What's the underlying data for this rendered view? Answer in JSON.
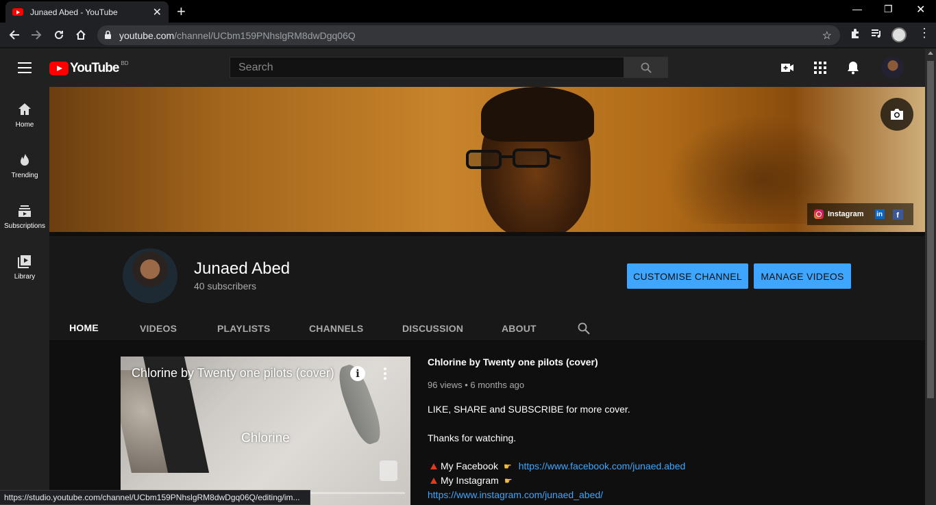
{
  "browser": {
    "tab_title": "Junaed Abed - YouTube",
    "url_host": "youtube.com",
    "url_path": "/channel/UCbm159PNhslgRM8dwDgq06Q",
    "status_url": "https://studio.youtube.com/channel/UCbm159PNhslgRM8dwDgq06Q/editing/im..."
  },
  "header": {
    "logo_text": "YouTube",
    "region": "BD",
    "search_placeholder": "Search"
  },
  "guide": {
    "items": [
      {
        "label": "Home",
        "icon": "home-icon"
      },
      {
        "label": "Trending",
        "icon": "flame-icon"
      },
      {
        "label": "Subscriptions",
        "icon": "subscriptions-icon"
      },
      {
        "label": "Library",
        "icon": "library-icon"
      }
    ]
  },
  "banner": {
    "links": {
      "instagram": "Instagram"
    }
  },
  "channel": {
    "name": "Junaed Abed",
    "subscribers": "40 subscribers",
    "customise_label": "CUSTOMISE CHANNEL",
    "manage_label": "MANAGE VIDEOS",
    "tabs": [
      "HOME",
      "VIDEOS",
      "PLAYLISTS",
      "CHANNELS",
      "DISCUSSION",
      "ABOUT"
    ]
  },
  "featured": {
    "player_title": "Chlorine by Twenty one pilots (cover)",
    "player_center_text": "Chlorine",
    "title": "Chlorine by Twenty one pilots (cover)",
    "meta": "96 views • 6 months ago",
    "line1": "LIKE, SHARE and SUBSCRIBE for more cover.",
    "line2": "Thanks for watching.",
    "fb_label": "My Facebook",
    "fb_url": "https://www.facebook.com/junaed.abed",
    "ig_label": "My Instagram",
    "ig_url": "https://www.instagram.com/junaed_abed/"
  },
  "colors": {
    "accent": "#3ea6ff",
    "brand": "#ff0000",
    "background": "#181818"
  }
}
